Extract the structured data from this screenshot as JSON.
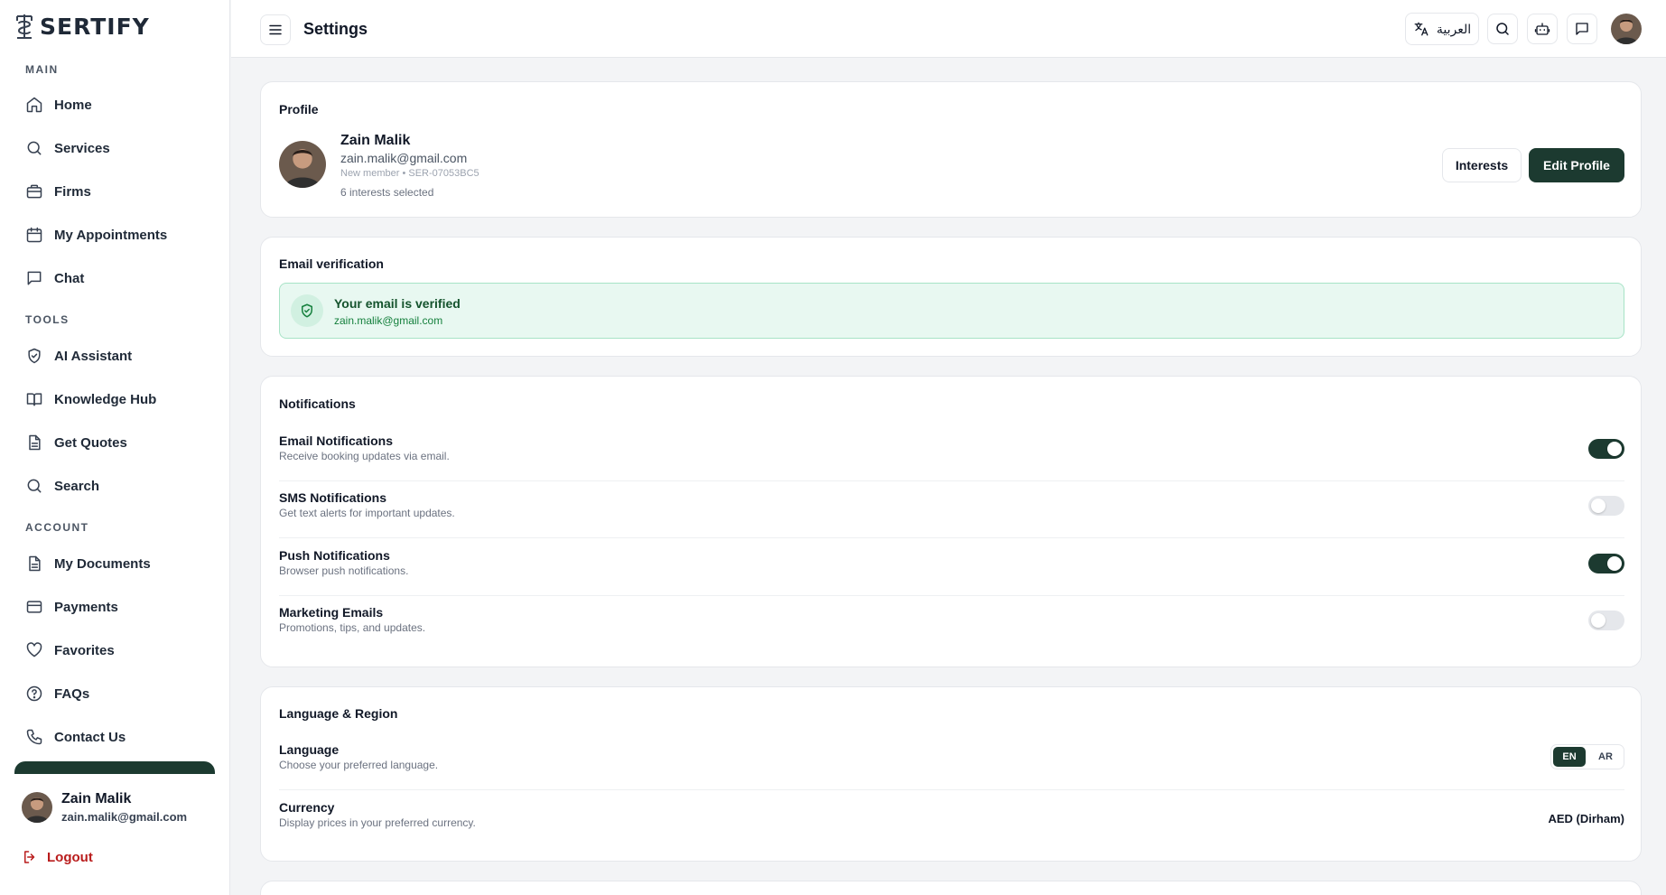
{
  "brand": {
    "name": "SERTIFY"
  },
  "colors": {
    "primary": "#1c3a30",
    "danger": "#b91c1c",
    "success_bg": "#e8f8f1"
  },
  "sidebar": {
    "sections": {
      "main": "MAIN",
      "tools": "TOOLS",
      "account": "ACCOUNT"
    },
    "items": [
      {
        "label": "Home",
        "icon": "home-icon"
      },
      {
        "label": "Services",
        "icon": "search-icon"
      },
      {
        "label": "Firms",
        "icon": "briefcase-icon"
      },
      {
        "label": "My Appointments",
        "icon": "calendar-icon"
      },
      {
        "label": "Chat",
        "icon": "chat-icon"
      },
      {
        "label": "AI Assistant",
        "icon": "shield-icon"
      },
      {
        "label": "Knowledge Hub",
        "icon": "book-icon"
      },
      {
        "label": "Get Quotes",
        "icon": "document-icon"
      },
      {
        "label": "Search",
        "icon": "search-icon"
      },
      {
        "label": "My Documents",
        "icon": "document-icon"
      },
      {
        "label": "Payments",
        "icon": "credit-card-icon"
      },
      {
        "label": "Favorites",
        "icon": "heart-icon"
      },
      {
        "label": "FAQs",
        "icon": "help-circle-icon"
      },
      {
        "label": "Contact Us",
        "icon": "phone-icon"
      }
    ],
    "user": {
      "name": "Zain Malik",
      "email": "zain.malik@gmail.com"
    },
    "logout_label": "Logout"
  },
  "topbar": {
    "title": "Settings",
    "language_button": "العربية"
  },
  "profile": {
    "section_title": "Profile",
    "name": "Zain Malik",
    "email": "zain.malik@gmail.com",
    "meta": "New member • SER-07053BC5",
    "interests": "6 interests selected",
    "interests_button": "Interests",
    "edit_button": "Edit Profile"
  },
  "email_verification": {
    "section_title": "Email verification",
    "status": "Your email is verified",
    "email": "zain.malik@gmail.com"
  },
  "notifications": {
    "section_title": "Notifications",
    "items": [
      {
        "title": "Email Notifications",
        "description": "Receive booking updates via email.",
        "enabled": true
      },
      {
        "title": "SMS Notifications",
        "description": "Get text alerts for important updates.",
        "enabled": false
      },
      {
        "title": "Push Notifications",
        "description": "Browser push notifications.",
        "enabled": true
      },
      {
        "title": "Marketing Emails",
        "description": "Promotions, tips, and updates.",
        "enabled": false
      }
    ]
  },
  "language_region": {
    "section_title": "Language & Region",
    "language": {
      "title": "Language",
      "description": "Choose your preferred language.",
      "options": [
        "EN",
        "AR"
      ],
      "selected": "EN"
    },
    "currency": {
      "title": "Currency",
      "description": "Display prices in your preferred currency.",
      "value": "AED (Dirham)"
    }
  }
}
